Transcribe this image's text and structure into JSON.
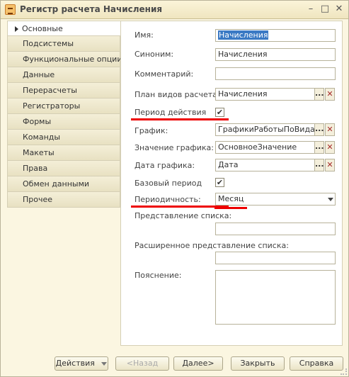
{
  "window": {
    "title": "Регистр расчета Начисления",
    "minimize": "–",
    "maximize": "□",
    "close": "✕"
  },
  "tabs": [
    {
      "label": "Основные"
    },
    {
      "label": "Подсистемы"
    },
    {
      "label": "Функциональные опции"
    },
    {
      "label": "Данные"
    },
    {
      "label": "Перерасчеты"
    },
    {
      "label": "Регистраторы"
    },
    {
      "label": "Формы"
    },
    {
      "label": "Команды"
    },
    {
      "label": "Макеты"
    },
    {
      "label": "Права"
    },
    {
      "label": "Обмен данными"
    },
    {
      "label": "Прочее"
    }
  ],
  "form": {
    "name_label": "Имя:",
    "name_value": "Начисления",
    "synonym_label": "Синоним:",
    "synonym_value": "Начисления",
    "comment_label": "Комментарий:",
    "comment_value": "",
    "plan_label": "План видов расчета:",
    "plan_value": "Начисления",
    "period_label": "Период действия",
    "period_checked": "✔",
    "schedule_label": "График:",
    "schedule_value": "ГрафикиРаботыПоВидамВ",
    "schedule_value_label": "Значение графика:",
    "schedule_value_value": "ОсновноеЗначение",
    "schedule_date_label": "Дата графика:",
    "schedule_date_value": "Дата",
    "base_period_label": "Базовый период",
    "base_period_checked": "✔",
    "periodicity_label": "Периодичность:",
    "periodicity_value": "Месяц",
    "list_repr_label": "Представление списка:",
    "ext_list_repr_label": "Расширенное представление списка:",
    "explanation_label": "Пояснение:",
    "dots": "...",
    "clear": "✕"
  },
  "buttons": {
    "actions": "Действия",
    "back": "<Назад",
    "next": "Далее>",
    "close": "Закрыть",
    "help": "Справка"
  },
  "colors": {
    "highlight": "#e00000",
    "selection": "#3a79c4"
  }
}
